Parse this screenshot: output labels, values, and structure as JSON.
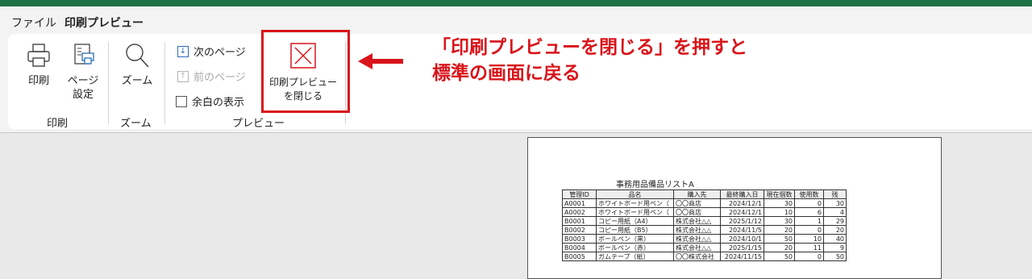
{
  "tabs": {
    "file": "ファイル",
    "print_preview": "印刷プレビュー"
  },
  "ribbon": {
    "print": {
      "label": "印刷",
      "group": "印刷"
    },
    "page_setup": {
      "line1": "ページ",
      "line2": "設定"
    },
    "zoom": {
      "label": "ズーム",
      "group": "ズーム"
    },
    "preview": {
      "next_page": "次のページ",
      "prev_page": "前のページ",
      "show_margins": "余白の表示",
      "close_line1": "印刷プレビュー",
      "close_line2": "を閉じる",
      "group": "プレビュー"
    }
  },
  "annotation": {
    "line1": "「印刷プレビューを閉じる」を押すと",
    "line2": "標準の画面に戻る",
    "color": "#d9141b"
  },
  "sheet": {
    "title": "事務用品備品リストA",
    "headers": [
      "管理ID",
      "品名",
      "購入先",
      "最終購入日",
      "現在個数",
      "使用数",
      "残"
    ],
    "rows": [
      [
        "A0001",
        "ホワイトボード用ペン（",
        "〇〇商店",
        "2024/12/1",
        "30",
        "0",
        "30"
      ],
      [
        "A0002",
        "ホワイトボード用ペン（",
        "〇〇商店",
        "2024/12/1",
        "10",
        "6",
        "4"
      ],
      [
        "B0001",
        "コピー用紙（A4）",
        "株式会社△△",
        "2025/1/12",
        "30",
        "1",
        "29"
      ],
      [
        "B0002",
        "コピー用紙（B5）",
        "株式会社△△",
        "2024/11/5",
        "20",
        "0",
        "20"
      ],
      [
        "B0003",
        "ボールペン（黒）",
        "株式会社△△",
        "2024/10/1",
        "50",
        "10",
        "40"
      ],
      [
        "B0004",
        "ボールペン（赤）",
        "株式会社△△",
        "2025/1/15",
        "20",
        "11",
        "9"
      ],
      [
        "B0005",
        "ガムテープ（紙）",
        "〇〇株式会社",
        "2024/11/15",
        "50",
        "0",
        "50"
      ]
    ]
  },
  "colors": {
    "accent": "#1e7145",
    "highlight": "#d9141b",
    "icon_blue": "#2b6cb5"
  }
}
